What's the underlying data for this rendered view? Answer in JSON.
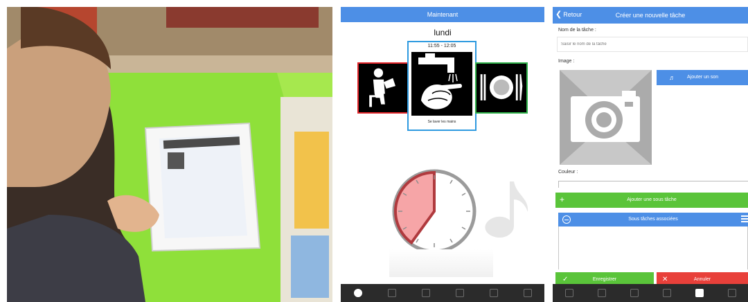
{
  "middle": {
    "header_title": "Maintenant",
    "day": "lundi",
    "current_time_range": "11:55 - 12:05",
    "current_caption": "Se laver les mains",
    "colors": {
      "left_frame": "#e3262b",
      "center_frame": "#2e9ae0",
      "right_frame": "#2fb14a",
      "timer_fill": "#f6a5a7",
      "timer_ring": "#b03a3e"
    },
    "timer_remaining_fraction": 0.4,
    "tabs": [
      "clock-icon",
      "calendar-icon",
      "document-icon",
      "mail-icon",
      "folder-icon",
      "gear-icon"
    ],
    "active_tab": 0
  },
  "right": {
    "back_label": "Retour",
    "title": "Créer une nouvelle tâche",
    "name_label": "Nom de la tâche :",
    "name_placeholder": "Saisir le nom de la tâche",
    "image_label": "Image :",
    "add_sound_label": "Ajouter un son",
    "color_label": "Couleur :",
    "add_subtask_label": "Ajouter une sous tâche",
    "subtasks_header": "Sous tâches associées",
    "save_label": "Enregistrer",
    "cancel_label": "Annuler",
    "colors": {
      "accent": "#4d8fe6",
      "green": "#5ac43a",
      "red": "#e8403a"
    },
    "tabs": [
      "clock-icon",
      "calendar-icon",
      "document-icon",
      "mail-icon",
      "folder-icon",
      "gear-icon"
    ],
    "active_tab": 4
  }
}
